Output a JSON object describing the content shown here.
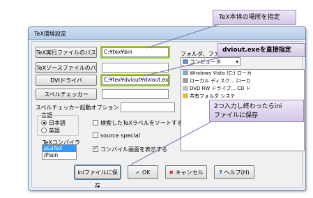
{
  "window": {
    "title": "TeX環境設定"
  },
  "left_buttons": {
    "tex_exe": "TeX実行ファイルのパス",
    "tex_source": "TeXソースファイルのパス",
    "dvi_driver": "DVIドライバ",
    "spell_checker": "スペルチェッカー"
  },
  "fields": {
    "tex_exe_value": "C:¥tex¥bin",
    "tex_source_value": "",
    "dvi_driver_value": "C:¥tex¥dviout¥dviout.exe",
    "spell_value": ""
  },
  "spell_option": {
    "label": "スペルチェッカー起動オプション",
    "value": ""
  },
  "language": {
    "label": "言語",
    "options": [
      "日本語",
      "英語"
    ],
    "selected": "日本語"
  },
  "compiler": {
    "label": "TeXコンパイラ",
    "items": [
      "pLaTeX",
      "jPlain"
    ],
    "selected": "pLaTeX"
  },
  "checks": {
    "sort_labels": "検索したTeXラベルをソートする",
    "source_special": "source special",
    "show_compile": "コンパイル画面を表示する"
  },
  "folder_panel": {
    "label": "フォルダ、ファイル",
    "dropdown": "コンピュータ",
    "items": [
      "Windows Vista (C:)  ローカ",
      "ローカル ディスク...  ローカ",
      "DVD RW ドライブ...  CD ド",
      "共有フォルダ       システ"
    ]
  },
  "bottom_buttons": {
    "save_ini": "iniファイルに保存",
    "ok": "OK",
    "cancel": "キャンセル",
    "help": "ヘルプ(H)"
  },
  "callouts": {
    "tex_location": "TeX本体の場所を指定",
    "dviout_direct": "dviout.exeを直接指定",
    "save_note_line1": "2つ入力し終わったらini",
    "save_note_line2": "ファイルに保存"
  },
  "colors": {
    "callout_purple": "#d3c6e6",
    "highlight_green": "#9ecb3a",
    "selection_blue": "#3399ff"
  }
}
